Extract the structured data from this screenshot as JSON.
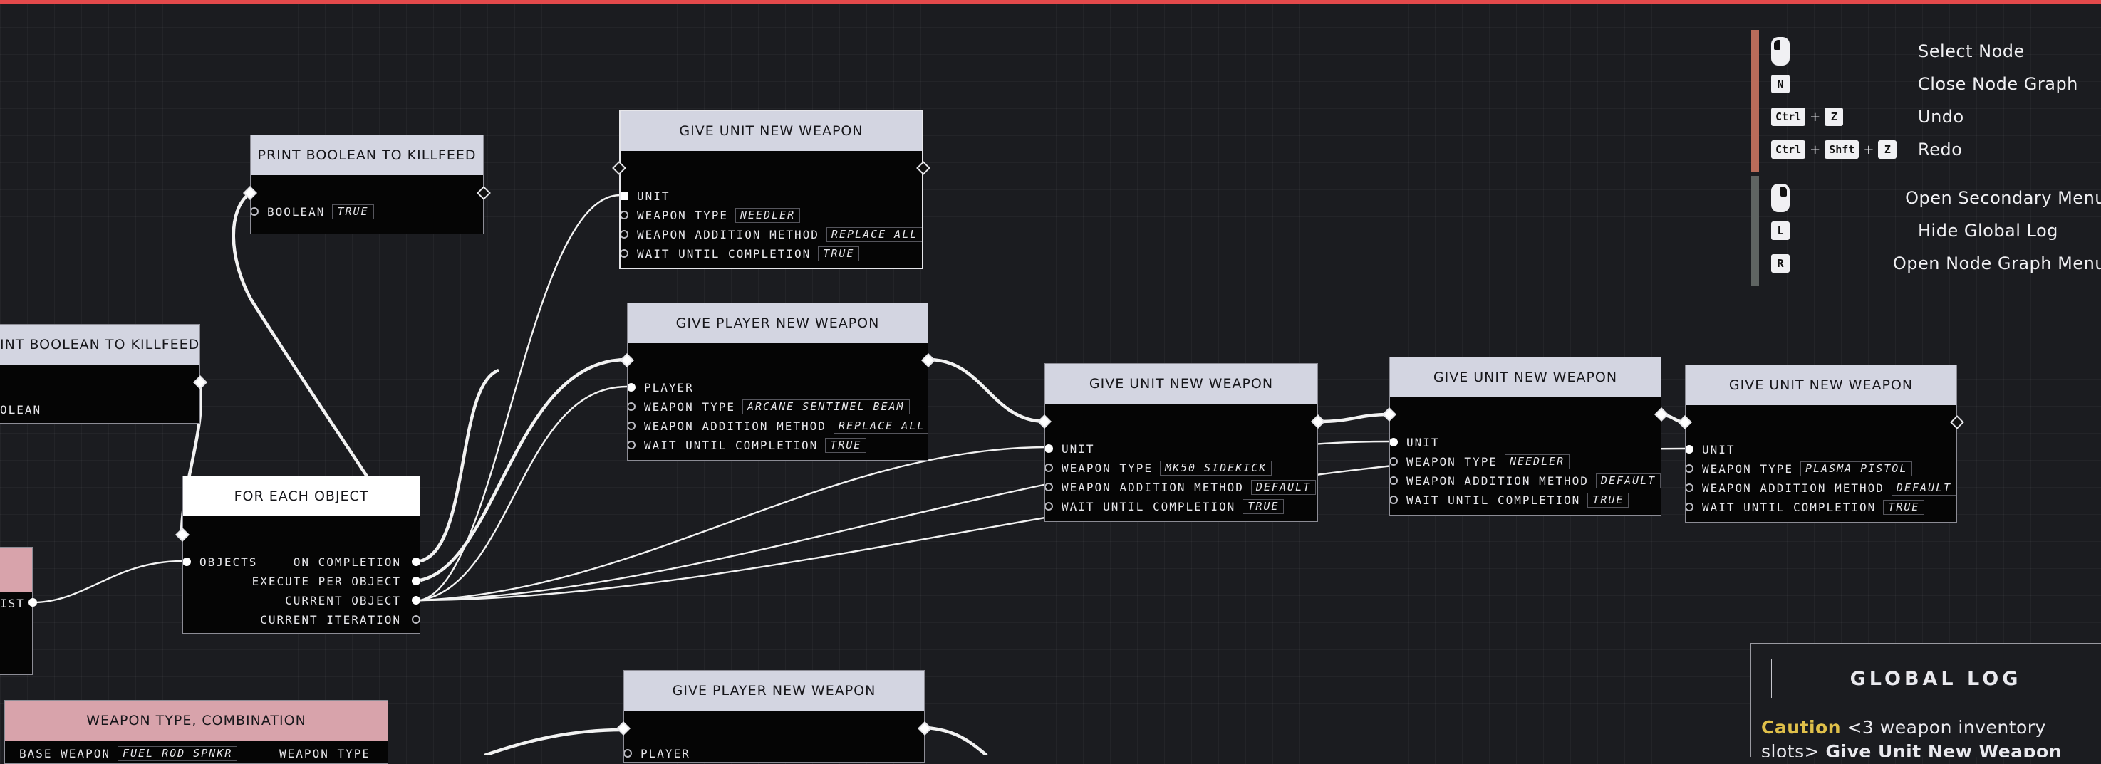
{
  "colors": {
    "accent": "#e4494b",
    "header": "#d3d5e1",
    "pink_header": "#d8a3ab",
    "caution": "#e0c04a",
    "bar_top": "#b96c5a",
    "bar_bottom": "#5f6462"
  },
  "nodes": {
    "print_boolean_a": {
      "title": "PRINT BOOLEAN TO KILLFEED",
      "boolean_label": "BOOLEAN",
      "boolean_value": "TRUE"
    },
    "print_boolean_b": {
      "title": "INT BOOLEAN TO KILLFEED",
      "boolean_label": "OLEAN"
    },
    "give_unit_1": {
      "title": "GIVE UNIT NEW WEAPON",
      "unit": "UNIT",
      "weapon_type_label": "WEAPON TYPE",
      "weapon_type": "NEEDLER",
      "method_label": "WEAPON ADDITION METHOD",
      "method": "REPLACE ALL",
      "wait_label": "WAIT UNTIL COMPLETION",
      "wait": "TRUE"
    },
    "give_player_1": {
      "title": "GIVE PLAYER NEW WEAPON",
      "player": "PLAYER",
      "weapon_type_label": "WEAPON TYPE",
      "weapon_type": "ARCANE SENTINEL BEAM",
      "method_label": "WEAPON ADDITION METHOD",
      "method": "REPLACE ALL",
      "wait_label": "WAIT UNTIL COMPLETION",
      "wait": "TRUE"
    },
    "give_unit_2": {
      "title": "GIVE UNIT NEW WEAPON",
      "unit": "UNIT",
      "weapon_type_label": "WEAPON TYPE",
      "weapon_type": "MK50 SIDEKICK",
      "method_label": "WEAPON ADDITION METHOD",
      "method": "DEFAULT",
      "wait_label": "WAIT UNTIL COMPLETION",
      "wait": "TRUE"
    },
    "give_unit_3": {
      "title": "GIVE UNIT NEW WEAPON",
      "unit": "UNIT",
      "weapon_type_label": "WEAPON TYPE",
      "weapon_type": "NEEDLER",
      "method_label": "WEAPON ADDITION METHOD",
      "method": "DEFAULT",
      "wait_label": "WAIT UNTIL COMPLETION",
      "wait": "TRUE"
    },
    "give_unit_4": {
      "title": "GIVE UNIT NEW WEAPON",
      "unit": "UNIT",
      "weapon_type_label": "WEAPON TYPE",
      "weapon_type": "PLASMA PISTOL",
      "method_label": "WEAPON ADDITION METHOD",
      "method": "DEFAULT",
      "wait_label": "WAIT UNTIL COMPLETION",
      "wait": "TRUE"
    },
    "for_each": {
      "title": "FOR EACH OBJECT",
      "objects": "OBJECTS",
      "on_completion": "ON COMPLETION",
      "execute_per_object": "EXECUTE PER OBJECT",
      "current_object": "CURRENT OBJECT",
      "current_iteration": "CURRENT ITERATION"
    },
    "list_stub": {
      "out_label": "IST"
    },
    "give_player_2": {
      "title": "GIVE PLAYER NEW WEAPON",
      "player": "PLAYER"
    },
    "weapon_combo": {
      "title": "WEAPON TYPE, COMBINATION",
      "base_label": "BASE WEAPON",
      "base_value": "FUEL ROD SPNKR",
      "out_label": "WEAPON TYPE"
    }
  },
  "controls": [
    {
      "keys": [
        "mouse-left"
      ],
      "label": "Select Node"
    },
    {
      "keys": [
        "N"
      ],
      "label": "Close Node Graph"
    },
    {
      "keys": [
        "Ctrl",
        "Z"
      ],
      "label": "Undo"
    },
    {
      "keys": [
        "Ctrl",
        "Shft",
        "Z"
      ],
      "label": "Redo"
    },
    {
      "keys": [
        "mouse-right"
      ],
      "label": "Open Secondary Menu"
    },
    {
      "keys": [
        "L"
      ],
      "label": "Hide Global Log"
    },
    {
      "keys": [
        "R"
      ],
      "label": "Open Node Graph Menu"
    }
  ],
  "global_log": {
    "title": "GLOBAL LOG",
    "caution": "Caution",
    "message": "<3 weapon inventory",
    "message2_a": "slots>",
    "message2_b": "Give Unit New Weapon"
  }
}
